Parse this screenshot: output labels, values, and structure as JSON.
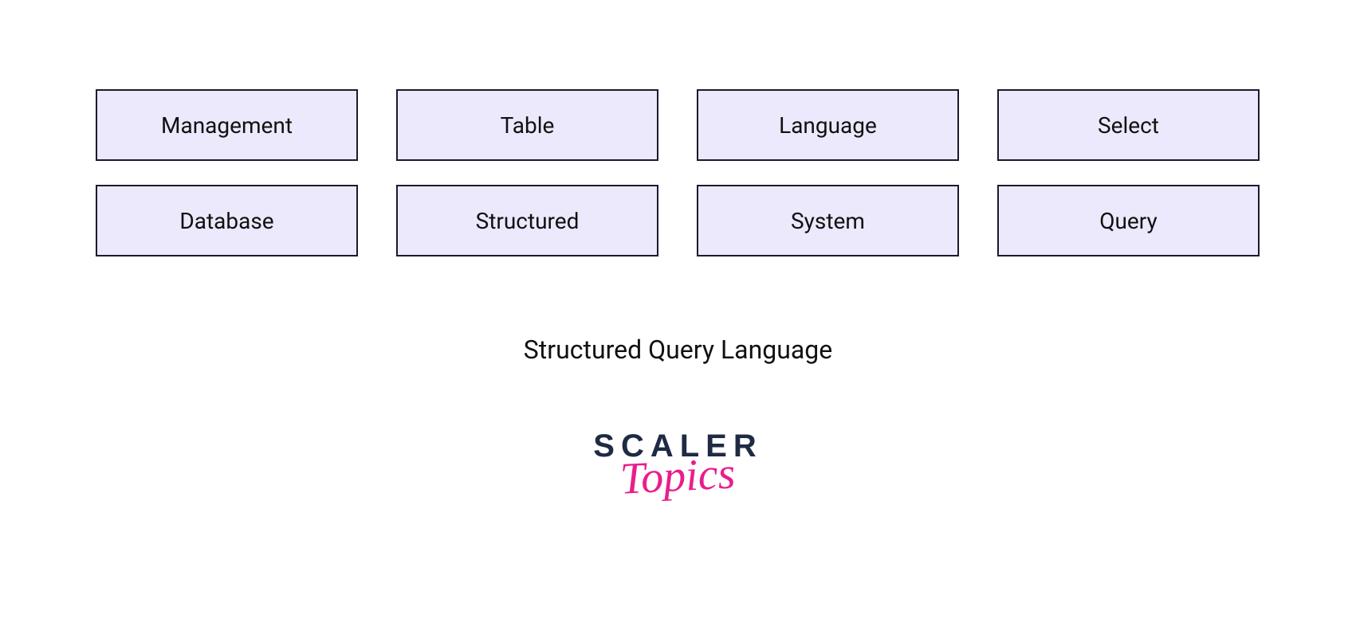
{
  "tiles": {
    "row1": [
      "Management",
      "Table",
      "Language",
      "Select"
    ],
    "row2": [
      "Database",
      "Structured",
      "System",
      "Query"
    ]
  },
  "caption": "Structured Query Language",
  "logo": {
    "top": "SCALER",
    "bottom": "Topics"
  }
}
